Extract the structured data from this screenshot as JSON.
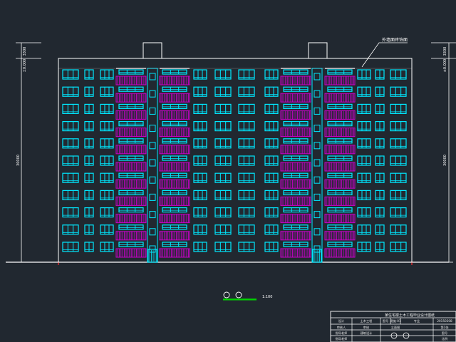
{
  "drawing": {
    "floors": 11,
    "colors": {
      "background": "#212830",
      "outline": "#ffffff",
      "window": "#00e8ff",
      "balcony": "#c800c8",
      "ground_mark": "#ff3030",
      "scale_bar": "#00d000"
    }
  },
  "annotation": {
    "note": "外墙面砖饰面",
    "scale_label": "1:100"
  },
  "dimensions": {
    "left_top_a": "3300",
    "left_top_b": "±0.000",
    "left_total": "30000",
    "right_top_a": "3300",
    "right_top_b": "±0.000",
    "right_total": "30000"
  },
  "title_block": {
    "header": "某住宅楼土木工程毕业设计图纸",
    "rows": [
      [
        "设计",
        "土木工程",
        "图号",
        "建施-01",
        "专业",
        "20150308"
      ],
      [
        "审核人",
        "审核",
        "",
        "立面图",
        "",
        "第1张"
      ],
      [
        "指导老师",
        "建筑设计",
        "",
        "",
        "",
        "图号"
      ],
      [
        "指导老师",
        "",
        "",
        "",
        "",
        "比例"
      ]
    ]
  }
}
